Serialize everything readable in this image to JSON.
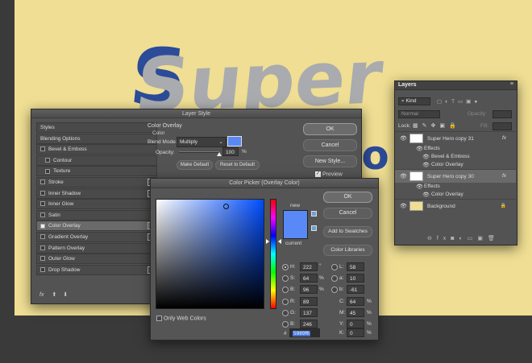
{
  "canvas": {
    "art_text_line1": "Super",
    "art_text_line2": "Hero"
  },
  "layer_style": {
    "title": "Layer Style",
    "items": [
      {
        "label": "Styles",
        "checkbox": false,
        "plus": false,
        "indent": false
      },
      {
        "label": "Blending Options",
        "checkbox": false,
        "plus": false,
        "indent": false
      },
      {
        "label": "Bevel & Emboss",
        "checkbox": true,
        "plus": false,
        "indent": false
      },
      {
        "label": "Contour",
        "checkbox": true,
        "plus": false,
        "indent": true
      },
      {
        "label": "Texture",
        "checkbox": true,
        "plus": false,
        "indent": true
      },
      {
        "label": "Stroke",
        "checkbox": true,
        "plus": true,
        "indent": false
      },
      {
        "label": "Inner Shadow",
        "checkbox": true,
        "plus": true,
        "indent": false
      },
      {
        "label": "Inner Glow",
        "checkbox": true,
        "plus": false,
        "indent": false
      },
      {
        "label": "Satin",
        "checkbox": true,
        "plus": false,
        "indent": false
      },
      {
        "label": "Color Overlay",
        "checkbox": true,
        "plus": true,
        "indent": false,
        "active": true
      },
      {
        "label": "Gradient Overlay",
        "checkbox": true,
        "plus": true,
        "indent": false
      },
      {
        "label": "Pattern Overlay",
        "checkbox": true,
        "plus": false,
        "indent": false
      },
      {
        "label": "Outer Glow",
        "checkbox": true,
        "plus": false,
        "indent": false
      },
      {
        "label": "Drop Shadow",
        "checkbox": true,
        "plus": true,
        "indent": false
      }
    ],
    "footer_fx": "fx",
    "section_title": "Color Overlay",
    "section_sub": "Color",
    "blend_mode_label": "Blend Mode:",
    "blend_mode_value": "Multiply",
    "opacity_label": "Opacity:",
    "opacity_value": "100",
    "opacity_unit": "%",
    "opacity_fraction": 1.0,
    "make_default": "Make Default",
    "reset_default": "Reset to Default",
    "ok": "OK",
    "cancel": "Cancel",
    "new_style": "New Style...",
    "preview": "Preview",
    "swatch_color": "#5989f6"
  },
  "layers": {
    "tab": "Layers",
    "filter_kind": "Kind",
    "blend": "Normal",
    "opacity_label": "Opacity:",
    "lock_label": "Lock:",
    "fill_label": "Fill:",
    "rows": [
      {
        "label": "Super Hero copy 31",
        "type": "layer",
        "fx": true
      },
      {
        "label": "Effects",
        "type": "effects"
      },
      {
        "label": "Bevel & Emboss",
        "type": "effect"
      },
      {
        "label": "Color Overlay",
        "type": "effect"
      },
      {
        "label": "Super Hero copy 30",
        "type": "layer",
        "fx": true,
        "selected": true
      },
      {
        "label": "Effects",
        "type": "effects"
      },
      {
        "label": "Color Overlay",
        "type": "effect"
      },
      {
        "label": "Background",
        "type": "background"
      }
    ],
    "fx_mark": "fx"
  },
  "color_picker": {
    "title": "Color Picker (Overlay Color)",
    "ok": "OK",
    "cancel": "Cancel",
    "add_swatches": "Add to Swatches",
    "color_libraries": "Color Libraries",
    "new_label": "new",
    "current_label": "current",
    "only_web": "Only Web Colors",
    "hue": 222,
    "new_color": "#5989f6",
    "current_color": "#5989f6",
    "H": {
      "label": "H:",
      "value": "222",
      "unit": "°"
    },
    "S": {
      "label": "S:",
      "value": "64",
      "unit": "%"
    },
    "Bv": {
      "label": "B:",
      "value": "96",
      "unit": "%"
    },
    "R": {
      "label": "R:",
      "value": "89"
    },
    "G": {
      "label": "G:",
      "value": "137"
    },
    "Bc": {
      "label": "B:",
      "value": "246"
    },
    "L": {
      "label": "L:",
      "value": "58"
    },
    "a": {
      "label": "a:",
      "value": "10"
    },
    "b": {
      "label": "b:",
      "value": "-61"
    },
    "C": {
      "label": "C:",
      "value": "64",
      "unit": "%"
    },
    "M": {
      "label": "M:",
      "value": "45",
      "unit": "%"
    },
    "Y": {
      "label": "Y:",
      "value": "0",
      "unit": "%"
    },
    "K": {
      "label": "K:",
      "value": "0",
      "unit": "%"
    },
    "hex_label": "#",
    "hex": "5989f6"
  }
}
